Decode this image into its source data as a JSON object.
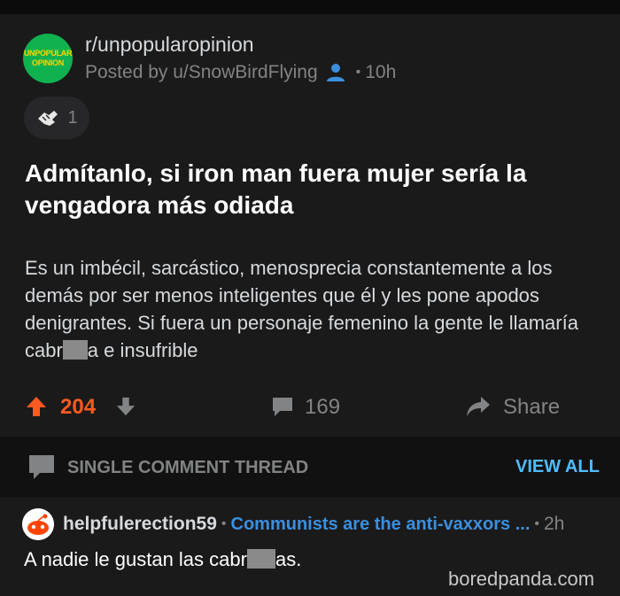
{
  "subreddit": {
    "name": "r/unpopularopinion",
    "avatar_line1": "UNPOPULAR",
    "avatar_line2": "OPINION",
    "posted_by": "Posted by u/SnowBirdFlying",
    "time": "10h"
  },
  "award": {
    "count": "1"
  },
  "post": {
    "title": "Admítanlo, si iron man fuera mujer sería la vengadora más odiada",
    "body_part1": "Es un imbécil, sarcástico, menosprecia constantemente a los demás por ser menos inteligentes que él y les pone apodos denigrantes. Si fuera un personaje femenino la gente le llamaría cabr",
    "body_part2": "a e insufrible"
  },
  "actions": {
    "score": "204",
    "comments": "169",
    "share": "Share"
  },
  "thread": {
    "label": "SINGLE COMMENT THREAD",
    "view_all": "VIEW ALL"
  },
  "comment": {
    "user": "helpfulerection59",
    "flair": "Communists are the anti-vaxxors ...",
    "time": "2h",
    "text_part1": "A nadie le gustan las cabr",
    "text_part2": "as."
  },
  "watermark": "boredpanda.com",
  "colors": {
    "upvote": "#ff5a1f",
    "link": "#4fbcff",
    "flair": "#3b8fde",
    "sub_avatar": "#0fb24f"
  }
}
